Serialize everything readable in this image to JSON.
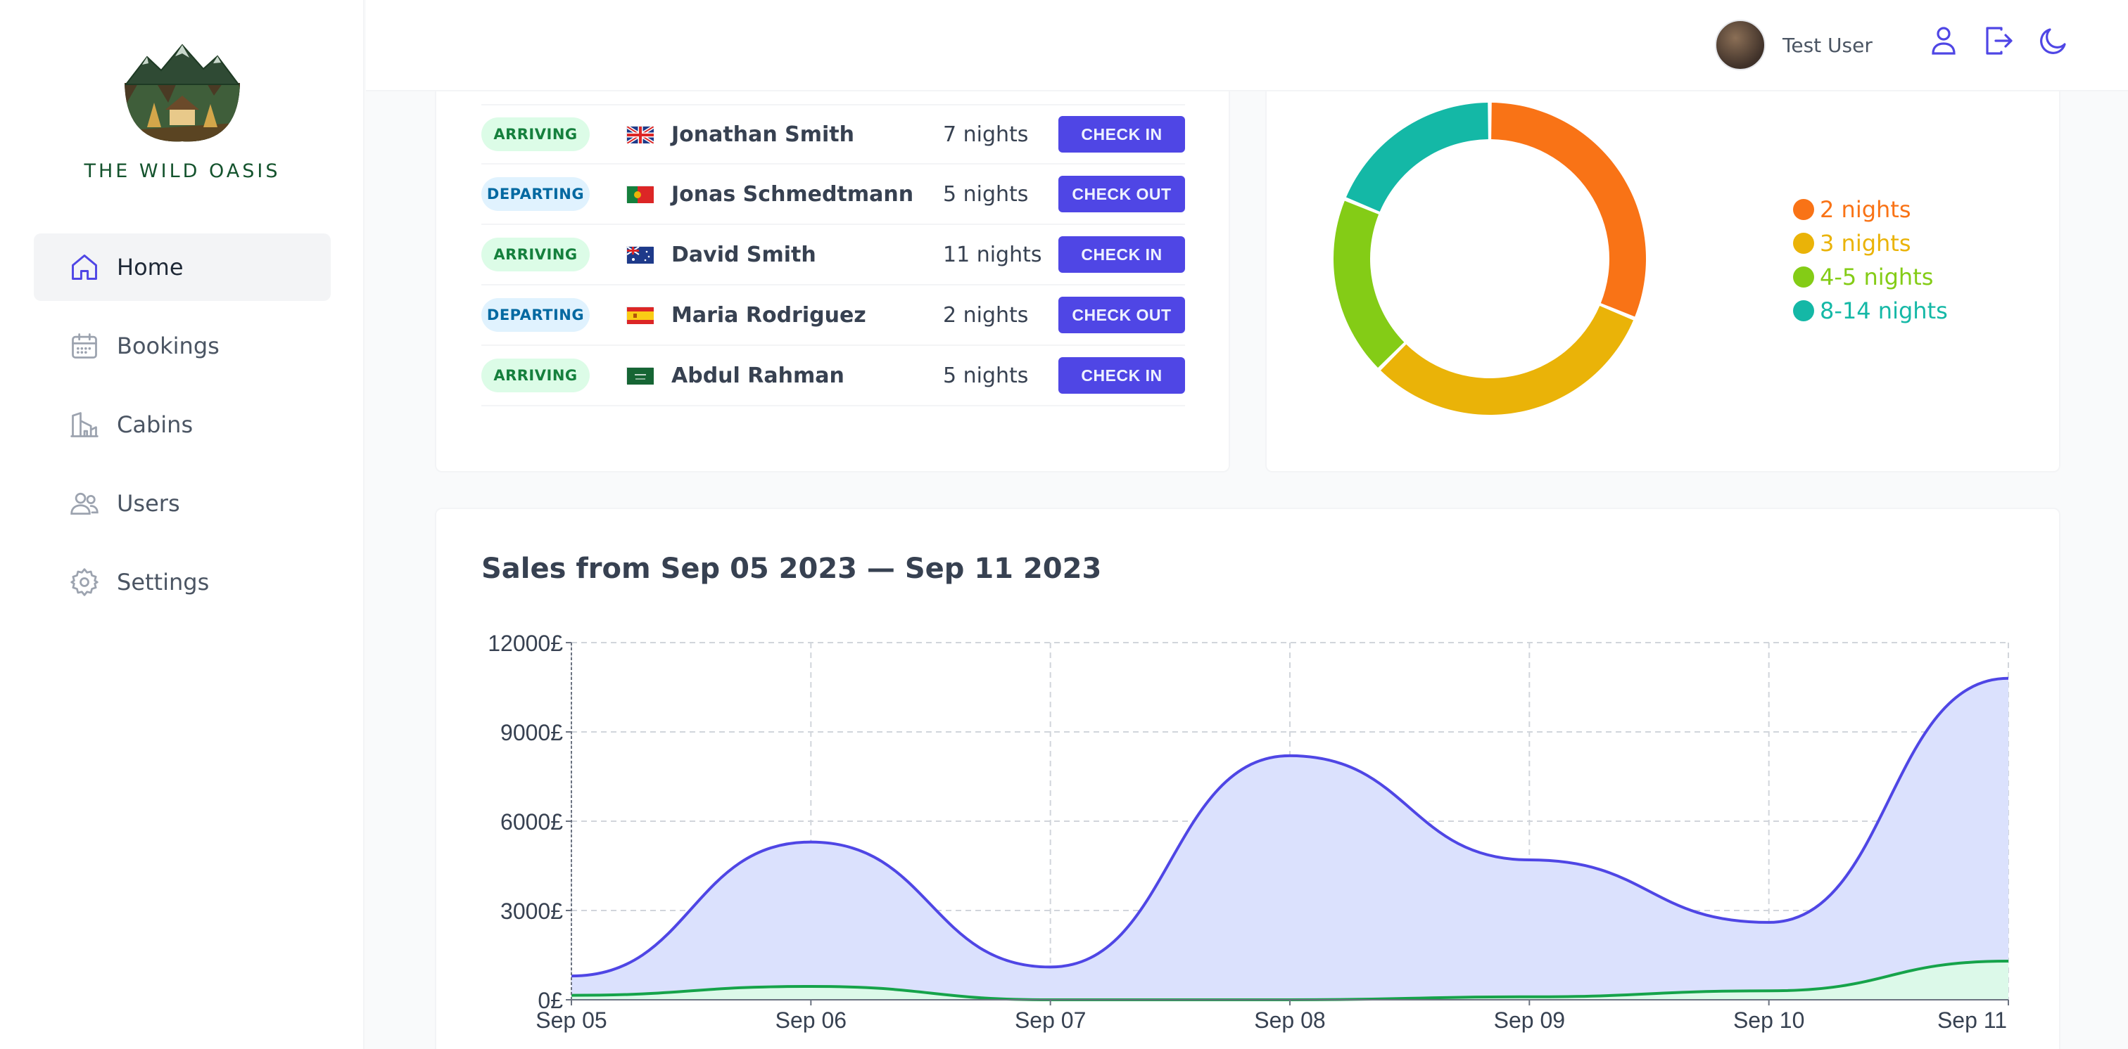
{
  "app": {
    "name": "THE WILD OASIS"
  },
  "sidebar": {
    "items": [
      {
        "label": "Home",
        "icon": "home-icon",
        "active": true
      },
      {
        "label": "Bookings",
        "icon": "calendar-icon",
        "active": false
      },
      {
        "label": "Cabins",
        "icon": "cabin-icon",
        "active": false
      },
      {
        "label": "Users",
        "icon": "users-icon",
        "active": false
      },
      {
        "label": "Settings",
        "icon": "gear-icon",
        "active": false
      }
    ]
  },
  "header": {
    "user_name": "Test User",
    "icons": [
      "user-icon",
      "logout-icon",
      "moon-icon"
    ]
  },
  "activity": {
    "rows": [
      {
        "status": "ARRIVING",
        "type": "arriving",
        "flag": "gb",
        "guest": "Jonathan Smith",
        "nights": "7 nights",
        "action": "CHECK IN"
      },
      {
        "status": "DEPARTING",
        "type": "departing",
        "flag": "pt",
        "guest": "Jonas Schmedtmann",
        "nights": "5 nights",
        "action": "CHECK OUT"
      },
      {
        "status": "ARRIVING",
        "type": "arriving",
        "flag": "au",
        "guest": "David Smith",
        "nights": "11 nights",
        "action": "CHECK IN"
      },
      {
        "status": "DEPARTING",
        "type": "departing",
        "flag": "es",
        "guest": "Maria Rodriguez",
        "nights": "2 nights",
        "action": "CHECK OUT"
      },
      {
        "status": "ARRIVING",
        "type": "arriving",
        "flag": "sa",
        "guest": "Abdul Rahman",
        "nights": "5 nights",
        "action": "CHECK IN"
      }
    ]
  },
  "duration": {
    "legend": [
      {
        "label": "2 nights",
        "color": "#f97316"
      },
      {
        "label": "3 nights",
        "color": "#eab308"
      },
      {
        "label": "4-5 nights",
        "color": "#84cc16"
      },
      {
        "label": "8-14 nights",
        "color": "#14b8a6"
      }
    ]
  },
  "sales": {
    "title": "Sales from Sep 05 2023 — Sep 11 2023"
  },
  "chart_data": [
    {
      "type": "pie",
      "categories": [
        "2 nights",
        "3 nights",
        "4-5 nights",
        "8-14 nights"
      ],
      "values": [
        1,
        1,
        0.6,
        0.6
      ],
      "colors": [
        "#f97316",
        "#eab308",
        "#84cc16",
        "#14b8a6"
      ],
      "legend": "right"
    },
    {
      "type": "area",
      "title": "Sales from Sep 05 2023 — Sep 11 2023",
      "x": [
        "Sep 05",
        "Sep 06",
        "Sep 07",
        "Sep 08",
        "Sep 09",
        "Sep 10",
        "Sep 11"
      ],
      "series": [
        {
          "values": [
            800,
            5300,
            1100,
            8200,
            4700,
            2600,
            10800
          ],
          "color": "#4f46e5",
          "fill": "#dbe1fd"
        },
        {
          "values": [
            150,
            450,
            0,
            0,
            100,
            300,
            1300
          ],
          "color": "#16a34a",
          "fill": "#dcfce7"
        }
      ],
      "yticks": [
        "0£",
        "3000£",
        "6000£",
        "9000£",
        "12000£"
      ],
      "ylim": [
        0,
        12000
      ],
      "grid": true
    }
  ]
}
